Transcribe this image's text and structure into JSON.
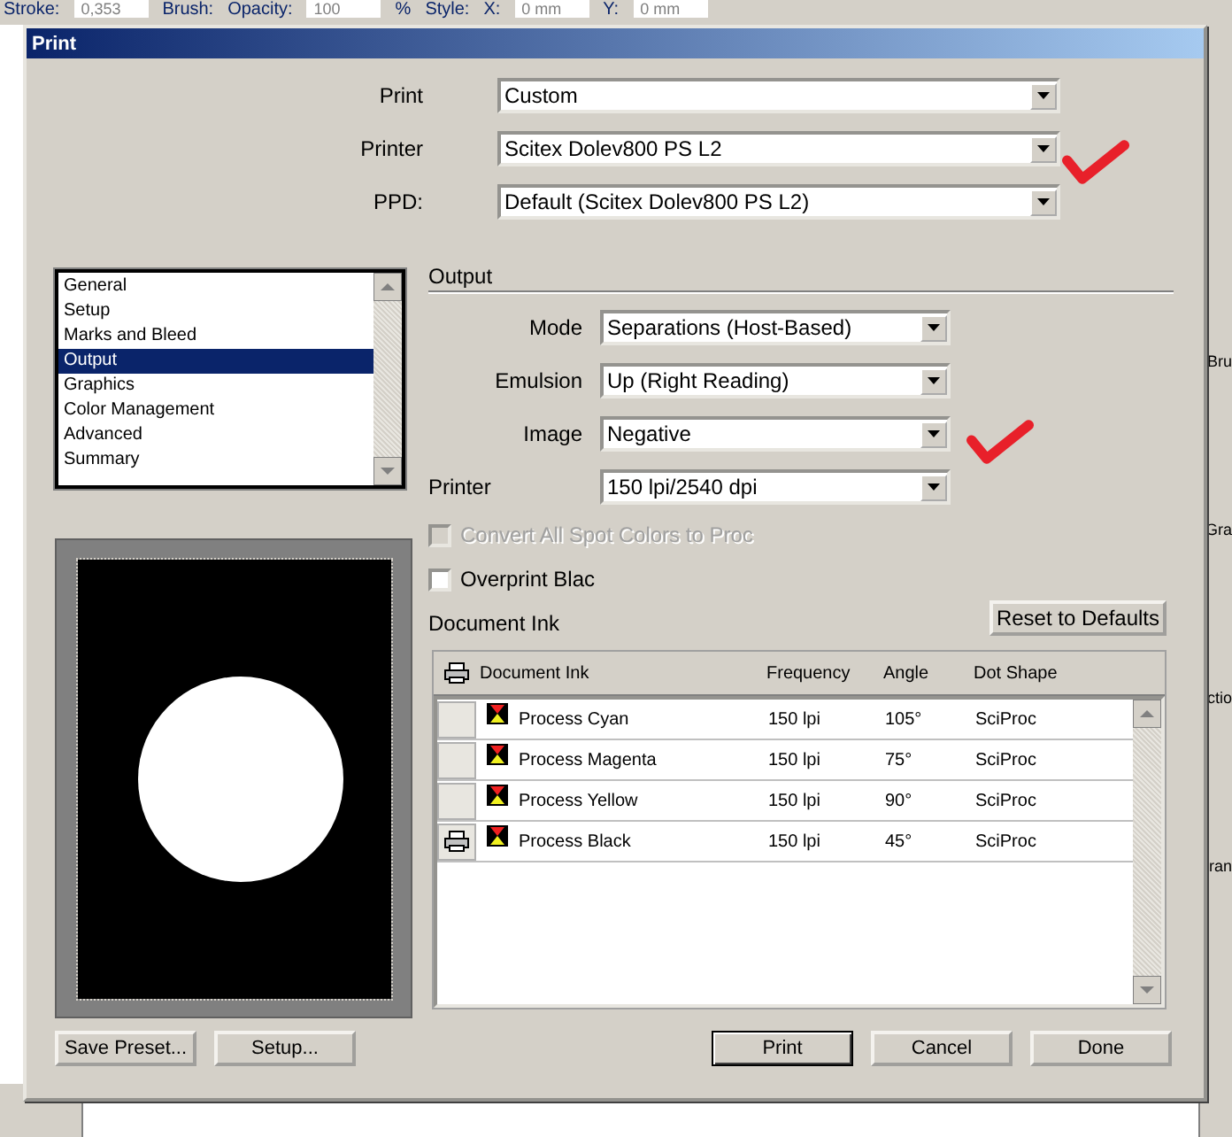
{
  "app_toolbar": [
    {
      "kind": "label",
      "text": "Stroke:"
    },
    {
      "kind": "field",
      "text": "0,353"
    },
    {
      "kind": "label",
      "text": "Brush:"
    },
    {
      "kind": "label",
      "text": "Opacity:"
    },
    {
      "kind": "field",
      "text": "100"
    },
    {
      "kind": "label",
      "text": "%"
    },
    {
      "kind": "label",
      "text": "Style:"
    },
    {
      "kind": "label",
      "text": "X:"
    },
    {
      "kind": "field",
      "text": "0 mm"
    },
    {
      "kind": "label",
      "text": "Y:"
    },
    {
      "kind": "field",
      "text": "0 mm"
    }
  ],
  "side_panel": [
    "Bru",
    "Gra",
    "ctio",
    "ran"
  ],
  "dialog": {
    "title": "Print",
    "print_settings": [
      {
        "label": "Print",
        "value": "Custom"
      },
      {
        "label": "Printer",
        "value": "Scitex Dolev800 PS L2"
      },
      {
        "label": "PPD:",
        "value": "Default (Scitex Dolev800 PS L2)"
      }
    ],
    "categories": [
      {
        "label": "General",
        "selected": false
      },
      {
        "label": "Setup",
        "selected": false
      },
      {
        "label": "Marks and Bleed",
        "selected": false
      },
      {
        "label": "Output",
        "selected": true
      },
      {
        "label": "Graphics",
        "selected": false
      },
      {
        "label": "Color Management",
        "selected": false
      },
      {
        "label": "Advanced",
        "selected": false
      },
      {
        "label": "Summary",
        "selected": false
      }
    ],
    "section_title": "Output",
    "output_fields": [
      {
        "kind": "indented",
        "label": "Mode",
        "value": "Separations (Host-Based)"
      },
      {
        "kind": "indented",
        "label": "Emulsion",
        "value": "Up (Right Reading)"
      },
      {
        "kind": "indented",
        "label": "Image",
        "value": "Negative"
      },
      {
        "kind": "flush",
        "label": "Printer",
        "value": "150 lpi/2540 dpi"
      }
    ],
    "options": [
      {
        "label": "Convert All Spot Colors to Proc",
        "checked": false,
        "disabled": true
      },
      {
        "label": "Overprint Blac",
        "checked": false,
        "disabled": false
      }
    ],
    "ink": {
      "title": "Document Ink",
      "reset_button": "Reset to Defaults",
      "columns": [
        "Document Ink",
        "Frequency",
        "Angle",
        "Dot Shape"
      ],
      "rows": [
        {
          "name": "Process Cyan",
          "frequency": "150 lpi",
          "angle": "105°",
          "dot_shape": "SciProc",
          "printed": false
        },
        {
          "name": "Process Magenta",
          "frequency": "150 lpi",
          "angle": "75°",
          "dot_shape": "SciProc",
          "printed": false
        },
        {
          "name": "Process Yellow",
          "frequency": "150 lpi",
          "angle": "90°",
          "dot_shape": "SciProc",
          "printed": false
        },
        {
          "name": "Process Black",
          "frequency": "150 lpi",
          "angle": "45°",
          "dot_shape": "SciProc",
          "printed": true
        }
      ]
    },
    "buttons_left": [
      "Save Preset...",
      "Setup..."
    ],
    "buttons_right": [
      {
        "label": "Print",
        "default": true
      },
      {
        "label": "Cancel",
        "default": false
      },
      {
        "label": "Done",
        "default": false
      }
    ]
  }
}
